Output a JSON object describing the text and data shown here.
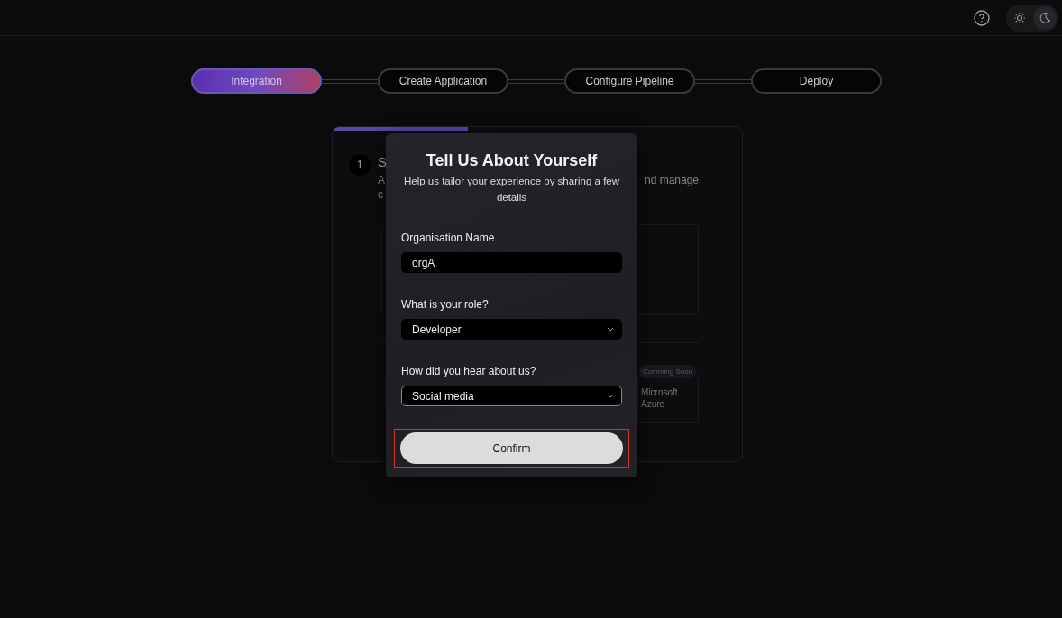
{
  "topbar": {
    "theme_options": [
      {
        "kind": "sun",
        "selected": false
      },
      {
        "kind": "moon",
        "selected": true
      }
    ]
  },
  "steps": [
    {
      "label": "Integration",
      "selected": true
    },
    {
      "label": "Create Application",
      "selected": false
    },
    {
      "label": "Configure Pipeline",
      "selected": false
    },
    {
      "label": "Deploy",
      "selected": false
    }
  ],
  "card": {
    "level": 0.33,
    "step_number": "1",
    "title_fragment": "S",
    "description_lines": [
      {
        "left": "A",
        "right": "nd manage"
      },
      {
        "left": "c"
      }
    ],
    "provider": {
      "badge": "Comming Soon",
      "name": "Microsoft Azure"
    }
  },
  "dialog": {
    "title": "Tell Us About Yourself",
    "subtitle": "Help us tailor your experience by sharing a few details",
    "fields": [
      {
        "kind": "text",
        "label": "Organisation Name",
        "value": "orgA",
        "focused": false
      },
      {
        "kind": "select",
        "label": "What is your role?",
        "value": "Developer",
        "focused": false
      },
      {
        "kind": "select",
        "label": "How did you hear about us?",
        "value": "Social media",
        "focused": true
      }
    ],
    "confirm": {
      "label": "Confirm",
      "highlighted": true
    }
  }
}
